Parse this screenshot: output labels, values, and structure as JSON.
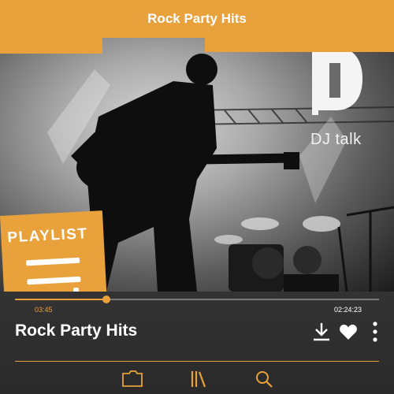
{
  "header": {
    "title": "Rock Party Hits"
  },
  "hero": {
    "brand_text": "DJ talk",
    "playlist_label": "PLAYLIST"
  },
  "player": {
    "progress": 0.25,
    "current_time": "03:45",
    "total_time": "02:24:23",
    "track_title": "Rock Party Hits"
  },
  "actions": [
    "download-icon",
    "heart-icon",
    "more-icon"
  ],
  "nav": [
    "folder-icon",
    "library-icon",
    "search-icon"
  ],
  "colors": {
    "accent": "#e8a13b",
    "background": "#2b2b2b",
    "text": "#ffffff"
  }
}
